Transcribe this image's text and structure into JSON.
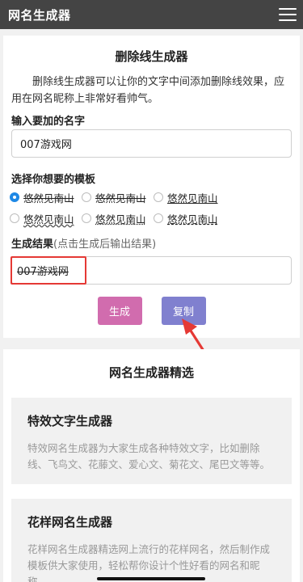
{
  "header": {
    "title": "网名生成器",
    "menu_icon": "hamburger-menu-icon"
  },
  "generator": {
    "heading": "删除线生成器",
    "description": "删除线生成器可以让你的文字中间添加删除线效果，应用在网名昵称上非常好看帅气。",
    "name_label": "输入要加的名字",
    "name_value": "007游戏网",
    "template_label": "选择你想要的模板",
    "templates": [
      {
        "text": "悠然见南山",
        "style": "strike",
        "selected": true
      },
      {
        "text": "悠然见南山",
        "style": "strike",
        "selected": false
      },
      {
        "text": "悠然见南山",
        "style": "under",
        "selected": false
      },
      {
        "text": "悠然见南山",
        "style": "wavy",
        "selected": false
      },
      {
        "text": "悠然见南山",
        "style": "dotted",
        "selected": false
      },
      {
        "text": "悠然见南山",
        "style": "dashed",
        "selected": false
      }
    ],
    "result_label": "生成结果",
    "result_hint": "(点击生成后输出结果)",
    "result_value": "007游戏网",
    "generate_label": "生成",
    "copy_label": "复制",
    "highlight_color": "#e53935"
  },
  "featured": {
    "heading": "网名生成器精选",
    "items": [
      {
        "title": "特效文字生成器",
        "desc": "特效网名生成器为大家生成各种特效文字，比如删除线、飞鸟文、花藤文、爱心文、菊花文、尾巴文等等。"
      },
      {
        "title": "花样网名生成器",
        "desc": "花样网名生成器精选网上流行的花样网名，然后制作成模板供大家使用，轻松帮你设计个性好看的网名和昵称。"
      }
    ]
  }
}
